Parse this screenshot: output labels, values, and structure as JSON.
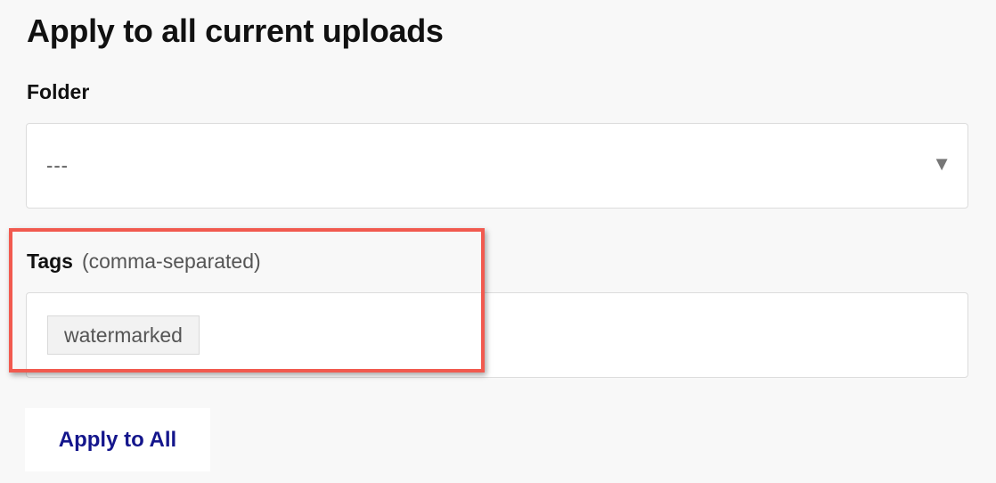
{
  "section": {
    "heading": "Apply to all current uploads"
  },
  "folder": {
    "label": "Folder",
    "selected_value": "---",
    "chevron": "▼"
  },
  "tags": {
    "label": "Tags",
    "hint": "(comma-separated)",
    "chips": [
      "watermarked"
    ]
  },
  "actions": {
    "apply_label": "Apply to All"
  },
  "colors": {
    "highlight": "#f15a4f",
    "button_text": "#14168c",
    "background": "#f8f8f8"
  }
}
